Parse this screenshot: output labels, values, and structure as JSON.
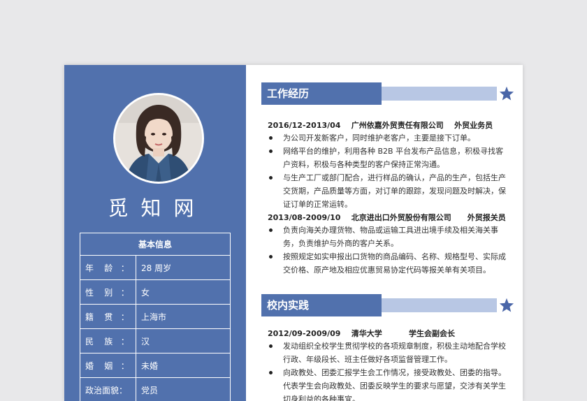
{
  "profile": {
    "name": "觅知网"
  },
  "basic_info": {
    "title": "基本信息",
    "rows": [
      {
        "label": "年    龄   ：",
        "value": "28 周岁"
      },
      {
        "label": "性    别   ：",
        "value": "女"
      },
      {
        "label": "籍    贯   ：",
        "value": "上海市"
      },
      {
        "label": "民    族   ：",
        "value": "汉"
      },
      {
        "label": "婚    姻   ：",
        "value": "未婚"
      },
      {
        "label": "政治面貌：",
        "value": "党员"
      }
    ]
  },
  "work": {
    "title": "工作经历",
    "jobs": [
      {
        "header": "2016/12-2013/04    广州依嘉外贸责任有限公司    外贸业务员",
        "bullets": [
          "为公司开发新客户，同时维护老客户，主要是接下订单。",
          "网络平台的维护，利用各种 B2B 平台发布产品信息，积极寻找客户资料，积极与各种类型的客户保持正常沟通。",
          "与生产工厂或部门配合，进行样品的确认，产品的生产，包括生产交货期，产品质量等方面，对订单的跟踪，发现问题及时解决，保证订单的正常运转。"
        ]
      },
      {
        "header": "2013/08-2009/10    北京进出口外贸股份有限公司      外贸报关员",
        "bullets": [
          "负责向海关办理货物、物品或运输工具进出境手续及相关海关事务，负责维护与外商的客户关系。",
          "按照规定如实申报出口货物的商品编码、名称、规格型号、实际成交价格、原产地及相应优惠贸易协定代码等报关单有关项目。"
        ]
      }
    ]
  },
  "campus": {
    "title": "校内实践",
    "jobs": [
      {
        "header": "2012/09-2009/09    清华大学          学生会副会长",
        "bullets": [
          "发动组织全校学生贯彻学校的各项规章制度，积极主动地配合学校行政、年级段长、班主任做好各项监督管理工作。",
          "向政教处、团委汇报学生会工作情况，接受政教处、团委的指导。代表学生会向政教处、团委反映学生的要求与愿望，交涉有关学生切身利益的各种事宜。"
        ]
      }
    ]
  },
  "colors": {
    "accent": "#5171ad",
    "accent_light": "#b8c7e4",
    "star": "#4a66a8"
  },
  "icons": [
    "star-icon",
    "avatar-photo"
  ]
}
